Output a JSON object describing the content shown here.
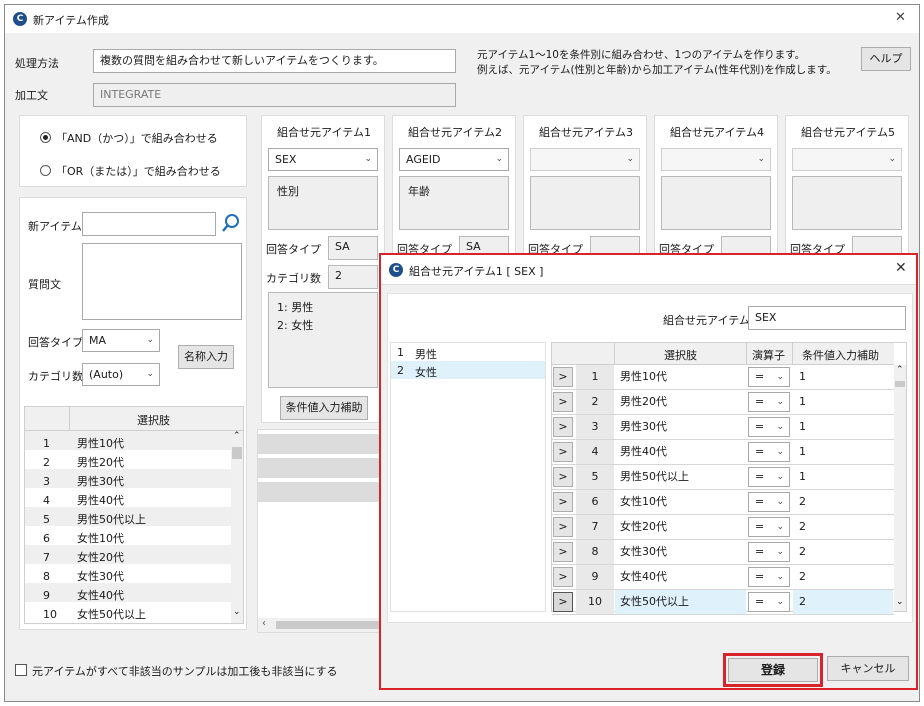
{
  "window": {
    "title": "新アイテム作成",
    "close_glyph": "✕"
  },
  "form": {
    "method_label": "処理方法",
    "method_value": "複数の質問を組み合わせて新しいアイテムをつくります。",
    "expr_label": "加工文",
    "expr_value": "INTEGRATE",
    "description_line1": "元アイテム1〜10を条件別に組み合わせ、1つのアイテムを作ります。",
    "description_line2": "例えば、元アイテム(性別と年齢)から加工アイテム(性年代別)を作成します。",
    "help_label": "ヘルプ"
  },
  "combine": {
    "and_label": "「AND（かつ）」で組み合わせる",
    "or_label": "「OR（または）」で組み合わせる",
    "selected": "and"
  },
  "new_item": {
    "item_label": "新アイテム",
    "item_value": "",
    "question_label": "質問文",
    "answer_type_label": "回答タイプ",
    "answer_type_value": "MA",
    "category_count_label": "カテゴリ数",
    "category_count_value": "(Auto)",
    "name_input_label": "名称入力",
    "choices_header": "選択肢",
    "choices": [
      {
        "no": "1",
        "label": "男性10代"
      },
      {
        "no": "2",
        "label": "男性20代"
      },
      {
        "no": "3",
        "label": "男性30代"
      },
      {
        "no": "4",
        "label": "男性40代"
      },
      {
        "no": "5",
        "label": "男性50代以上"
      },
      {
        "no": "6",
        "label": "女性10代"
      },
      {
        "no": "7",
        "label": "女性20代"
      },
      {
        "no": "8",
        "label": "女性30代"
      },
      {
        "no": "9",
        "label": "女性40代"
      },
      {
        "no": "10",
        "label": "女性50代以上"
      }
    ]
  },
  "source_items": {
    "answer_type_label": "回答タイプ",
    "category_count_label": "カテゴリ数",
    "assist_label": "条件値入力補助",
    "items": [
      {
        "title": "組合せ元アイテム1",
        "code": "SEX",
        "name": "性別",
        "answer_type": "SA",
        "category_count": "2",
        "categories": [
          "1: 男性",
          "2: 女性"
        ]
      },
      {
        "title": "組合せ元アイテム2",
        "code": "AGEID",
        "name": "年齢",
        "answer_type": "SA"
      },
      {
        "title": "組合せ元アイテム3",
        "code": "",
        "name": ""
      },
      {
        "title": "組合せ元アイテム4",
        "code": "",
        "name": ""
      },
      {
        "title": "組合せ元アイテム5",
        "code": "",
        "name": ""
      }
    ]
  },
  "footer": {
    "nonapplicable_label": "元アイテムがすべて非該当のサンプルは加工後も非該当にする"
  },
  "dialog": {
    "title": "組合せ元アイテム1 [ SEX ]",
    "close_glyph": "✕",
    "source_label": "組合せ元アイテム1",
    "source_value": "SEX",
    "categories": [
      {
        "no": "1",
        "label": "男性"
      },
      {
        "no": "2",
        "label": "女性"
      }
    ],
    "grid_headers": {
      "choice": "選択肢",
      "operator": "演算子",
      "assist": "条件値入力補助"
    },
    "rows": [
      {
        "no": "1",
        "choice": "男性10代",
        "op": "=",
        "value": "1"
      },
      {
        "no": "2",
        "choice": "男性20代",
        "op": "=",
        "value": "1"
      },
      {
        "no": "3",
        "choice": "男性30代",
        "op": "=",
        "value": "1"
      },
      {
        "no": "4",
        "choice": "男性40代",
        "op": "=",
        "value": "1"
      },
      {
        "no": "5",
        "choice": "男性50代以上",
        "op": "=",
        "value": "1"
      },
      {
        "no": "6",
        "choice": "女性10代",
        "op": "=",
        "value": "2"
      },
      {
        "no": "7",
        "choice": "女性20代",
        "op": "=",
        "value": "2"
      },
      {
        "no": "8",
        "choice": "女性30代",
        "op": "=",
        "value": "2"
      },
      {
        "no": "9",
        "choice": "女性40代",
        "op": "=",
        "value": "2"
      },
      {
        "no": "10",
        "choice": "女性50代以上",
        "op": "=",
        "value": "2"
      }
    ],
    "selected_row": "10",
    "row_marker": ">",
    "register_label": "登録",
    "cancel_label": "キャンセル"
  },
  "colors": {
    "highlight": "#d9232a",
    "selection": "#dff1fb"
  }
}
